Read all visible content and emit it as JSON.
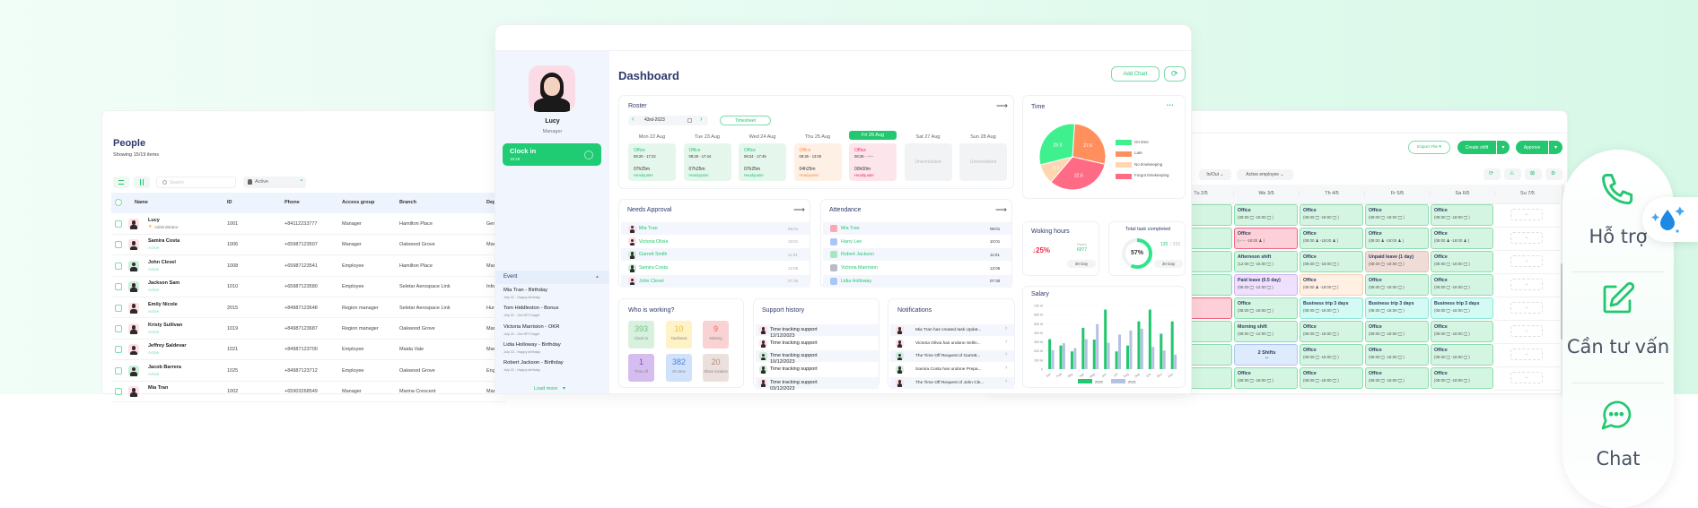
{
  "people": {
    "title": "People",
    "subtitle": "Showing 15/19 items",
    "search_placeholder": "Search",
    "status_filter": "Active",
    "columns": [
      "Name",
      "ID",
      "Phone",
      "Access group",
      "Branch",
      "Dep"
    ],
    "rows": [
      {
        "name": "Lucy",
        "sub": "Administrator",
        "id": "1001",
        "phone": "+84112233777",
        "group": "Manager",
        "branch": "Hamilton Place",
        "dep": "Gen"
      },
      {
        "name": "Samira Costa",
        "sub": "Active",
        "id": "1006",
        "phone": "+65987123507",
        "group": "Manager",
        "branch": "Oakwood Grove",
        "dep": "Mar"
      },
      {
        "name": "John Clevel",
        "sub": "Active",
        "id": "1008",
        "phone": "+65987123541",
        "group": "Employee",
        "branch": "Hamilton Place",
        "dep": "Mar"
      },
      {
        "name": "Jackson Sam",
        "sub": "Active",
        "id": "1010",
        "phone": "+65987123580",
        "group": "Employee",
        "branch": "Seletar Aerospace Link",
        "dep": "Info"
      },
      {
        "name": "Emily Nicole",
        "sub": "Active",
        "id": "2015",
        "phone": "+84987123648",
        "group": "Region manager",
        "branch": "Seletar Aerospace Link",
        "dep": "Hur"
      },
      {
        "name": "Kristy Sullivan",
        "sub": "Active",
        "id": "1019",
        "phone": "+84987123687",
        "group": "Region manager",
        "branch": "Oakwood Grove",
        "dep": "Mar"
      },
      {
        "name": "Jeffrey Saldevar",
        "sub": "Active",
        "id": "1021",
        "phone": "+84987123700",
        "group": "Employee",
        "branch": "Maida Vale",
        "dep": "Mar"
      },
      {
        "name": "Jacob Barrera",
        "sub": "Active",
        "id": "1025",
        "phone": "+84987123712",
        "group": "Employee",
        "branch": "Oakwood Grove",
        "dep": "Eng"
      },
      {
        "name": "Mia Tran",
        "sub": "",
        "id": "1002",
        "phone": "+65903268549",
        "group": "Manager",
        "branch": "Marina Crescent",
        "dep": "Mar"
      }
    ]
  },
  "dashboard": {
    "user": {
      "name": "Lucy",
      "role": "Manager"
    },
    "clock_in": {
      "label": "Clock in",
      "time": "18:29"
    },
    "event": {
      "title": "Event",
      "items": [
        {
          "title": "Mia Tran - Birthday",
          "sub": "July 22 - Happy birthday"
        },
        {
          "title": "Tom Hiddleston - Bonus",
          "sub": "July 22 - Get KPI Target"
        },
        {
          "title": "Victoria Marrision - OKR",
          "sub": "July 22 - Get KPI Target"
        },
        {
          "title": "Lidia Holloway - Birthday",
          "sub": "July 22 - Happy birthday"
        },
        {
          "title": "Robert Jackson - Birthday",
          "sub": "July 22 - Happy birthday"
        }
      ],
      "load_more": "Load more"
    },
    "title": "Dashboard",
    "add_chart": "Add Chart",
    "roster": {
      "title": "Roster",
      "date": "43rd-2023",
      "timesheet": "Timesheet",
      "days": [
        {
          "day": "Mon 22 Aug",
          "loc": "Office",
          "time": "08:20 - 17:22",
          "dur": "07h25m",
          "site": "Headquater",
          "status": "ok"
        },
        {
          "day": "Tue 23 Aug",
          "loc": "Office",
          "time": "08:29 - 17:44",
          "dur": "07h25m",
          "site": "Headquater",
          "status": "ok"
        },
        {
          "day": "Wed 24 Aug",
          "loc": "Office",
          "time": "08:24 - 17:45",
          "dur": "07h25m",
          "site": "Headquater",
          "status": "ok"
        },
        {
          "day": "Thu 25 Aug",
          "loc": "Office",
          "time": "08:26 - 13:00",
          "dur": "04h25m",
          "site": "Headquater",
          "status": "late"
        },
        {
          "day": "Fri 26 Aug",
          "loc": "Office",
          "time": "08:26 - --:--",
          "dur": "00h00m",
          "site": "Headquater",
          "status": "missing",
          "today": true
        },
        {
          "day": "Sat 27 Aug",
          "unscheduled": "Unscheduled"
        },
        {
          "day": "Sun 28 Aug",
          "unscheduled": "Unscheduled"
        }
      ]
    },
    "needs_approval": {
      "title": "Needs Approval",
      "rows": [
        {
          "name": "Mia Tran",
          "time": "09:01"
        },
        {
          "name": "Victoria Olivia",
          "time": "10:01"
        },
        {
          "name": "Garrett Smith",
          "time": "11:01"
        },
        {
          "name": "Samira Costa",
          "time": "12:05"
        },
        {
          "name": "John Clevel",
          "time": "07:30"
        }
      ]
    },
    "attendance": {
      "title": "Attendance",
      "rows": [
        {
          "name": "Mia Tran",
          "time": "09:01"
        },
        {
          "name": "Harry Lee",
          "time": "10:01"
        },
        {
          "name": "Robert Jackson",
          "time": "11:01"
        },
        {
          "name": "Victoria Marrision",
          "time": "12:05"
        },
        {
          "name": "Lidia Holloway",
          "time": "07:30"
        }
      ]
    },
    "who_is_working": {
      "title": "Who is working?",
      "tiles": [
        {
          "value": "393",
          "label": "Clock in",
          "bg": "#d8f1de",
          "fg": "#6fc284"
        },
        {
          "value": "10",
          "label": "Tardiness",
          "bg": "#fdf3c6",
          "fg": "#e8c13f"
        },
        {
          "value": "9",
          "label": "Missing",
          "bg": "#f9d3d3",
          "fg": "#ef6464"
        },
        {
          "value": "1",
          "label": "Time off",
          "bg": "#d6bdf0",
          "fg": "#8448c6"
        },
        {
          "value": "382",
          "label": "On time",
          "bg": "#d0e1fb",
          "fg": "#4c84e4"
        },
        {
          "value": "20",
          "label": "Share location",
          "bg": "#ebe0dc",
          "fg": "#b98c7d"
        }
      ]
    },
    "support_history": {
      "title": "Support history",
      "items": [
        {
          "title": "Time tracking support",
          "date": "12/12/2023"
        },
        {
          "title": "Time tracking support",
          "date": ""
        },
        {
          "title": "Time tracking support",
          "date": "10/12/2023"
        },
        {
          "title": "Time tracking support",
          "date": ""
        },
        {
          "title": "Time tracking support",
          "date": "03/12/2023"
        }
      ]
    },
    "notifications": {
      "title": "Notifications",
      "items": [
        "Mia Tran has created task Updat...",
        "Victoria Olivia has undone Sellin...",
        "The Time Off Request of Garrett...",
        "Samira Costa has undone Prepa...",
        "The Time Off Request of John Cle..."
      ]
    },
    "time": {
      "title": "Time"
    },
    "working_hours": {
      "title": "Woking hours",
      "change": "↓25%",
      "hours_label": "Hours",
      "hours": "6977",
      "period": "30 Day"
    },
    "total_task": {
      "title": "Total task completed",
      "percent": 57,
      "percent_label": "57%",
      "done": "125",
      "total": "/ 250",
      "period": "30 Day"
    },
    "salary": {
      "title": "Salary"
    }
  },
  "schedule": {
    "export": "Export File",
    "create_shift": "Create shift",
    "approve": "Approve",
    "filters": [
      "In/Out",
      "Active employee"
    ],
    "days": [
      "Tu 2/5",
      "We 3/5",
      "Th 4/5",
      "Fr 5/5",
      "Sa 6/5",
      "Su 7/5"
    ],
    "rows": [
      [
        {
          "t": "",
          "s": "18:00 🖵 )",
          "k": "g"
        },
        {
          "t": "Office",
          "s": "(08:00 🖵 -18:00 🖵 )",
          "k": "g"
        },
        {
          "t": "Office",
          "s": "(08:00 🖵 -18:00 🖵 )",
          "k": "g"
        },
        {
          "t": "Office",
          "s": "(08:00 🖵 -18:00 🖵 )",
          "k": "g"
        },
        {
          "t": "Office",
          "s": "(08:00 🖵 -18:00 🖵 )",
          "k": "g"
        }
      ],
      [
        {
          "t": "",
          "s": "18:00 ♟ )",
          "k": "g"
        },
        {
          "t": "Office",
          "s": "(--:-- -18:00 ♟ )",
          "k": "r"
        },
        {
          "t": "Office",
          "s": "(08:00 ♟ -18:00 ♟ )",
          "k": "g"
        },
        {
          "t": "Office",
          "s": "(08:00 ♟ -18:00 ♟ )",
          "k": "g"
        },
        {
          "t": "Office",
          "s": "(08:00 ♟ -18:00 ♟ )",
          "k": "g"
        }
      ],
      [
        {
          "t": "n shift",
          "s": "16:00 🖵 )",
          "k": "g"
        },
        {
          "t": "Afternoon shift",
          "s": "(12:00 🖵 -16:00 🖵 )",
          "k": "g"
        },
        {
          "t": "Office",
          "s": "(08:00 🖵 -18:00 🖵 )",
          "k": "g"
        },
        {
          "t": "Unpaid leave (1 day)",
          "s": "(08:00 🖵 -18:00 🖵 )",
          "k": "b"
        },
        {
          "t": "Office",
          "s": "(08:00 🖵 -18:00 🖵 )",
          "k": "g"
        }
      ],
      [
        {
          "t": "",
          "s": "18:00 🖵 )",
          "k": "g"
        },
        {
          "t": "Paid leave (0.5 day)",
          "s": "(08:00 🖵 -12:00 🖵 )",
          "k": "p"
        },
        {
          "t": "Office",
          "s": "(08:00 ♟ -18:00 🖵 )",
          "k": "o"
        },
        {
          "t": "Office",
          "s": "(08:00 🖵 -18:00 🖵 )",
          "k": "g"
        },
        {
          "t": "Office",
          "s": "(08:00 🖵 -18:00 🖵 )",
          "k": "g"
        }
      ],
      [
        {
          "t": "",
          "s": "--:-- )",
          "k": "r"
        },
        {
          "t": "Office",
          "s": "(08:00 🖵 -18:00 🖵 )",
          "k": "g"
        },
        {
          "t": "Business trip 3 days",
          "s": "(08:00 🖵 -18:00 🖵 )",
          "k": "c"
        },
        {
          "t": "Business trip 3 days",
          "s": "(08:00 🖵 -18:00 🖵 )",
          "k": "c"
        },
        {
          "t": "Business trip 3 days",
          "s": "(08:00 🖵 -18:00 🖵 )",
          "k": "c"
        }
      ],
      [
        {
          "t": "hift",
          "s": "12:00 🖵 )",
          "k": "g"
        },
        {
          "t": "Morning shift",
          "s": "(08:00 🖵 -12:00 🖵 )",
          "k": "g"
        },
        {
          "t": "Office",
          "s": "(08:00 🖵 -18:00 🖵 )",
          "k": "g"
        },
        {
          "t": "Office",
          "s": "(08:00 🖵 -18:00 🖵 )",
          "k": "g"
        },
        {
          "t": "Office",
          "s": "(08:00 🖵 -18:00 🖵 )",
          "k": "g"
        }
      ],
      [
        {
          "t": "",
          "s": "18:00 🖵 )",
          "k": "g"
        },
        {
          "t": "2 Shifts",
          "s": "",
          "k": "u"
        },
        {
          "t": "Office",
          "s": "(08:00 🖵 -18:00 🖵 )",
          "k": "g"
        },
        {
          "t": "Office",
          "s": "(08:00 🖵 -18:00 🖵 )",
          "k": "g"
        },
        {
          "t": "Office",
          "s": "(08:00 🖵 -18:00 🖵 )",
          "k": "g"
        }
      ],
      [
        {
          "t": "",
          "s": "18:00 🖵 )",
          "k": "g"
        },
        {
          "t": "Office",
          "s": "(08:00 🖵 -18:00 🖵 )",
          "k": "g"
        },
        {
          "t": "Office",
          "s": "(08:00 🖵 -18:00 🖵 )",
          "k": "g"
        },
        {
          "t": "Office",
          "s": "(08:00 🖵 -18:00 🖵 )",
          "k": "g"
        },
        {
          "t": "Office",
          "s": "(08:00 🖵 -18:00 🖵 )",
          "k": "g"
        }
      ]
    ],
    "add_symbol": "+"
  },
  "widget": {
    "items": [
      {
        "label": "Hỗ trợ",
        "icon": "phone-icon"
      },
      {
        "label": "Cần tư vấn",
        "icon": "edit-icon"
      },
      {
        "label": "Chat",
        "icon": "chat-icon"
      }
    ],
    "bubble_icon": "water-drop-icon"
  },
  "colors": {
    "accent": "#22c76f",
    "navy": "#2d3a6b"
  },
  "chart_data": [
    {
      "type": "pie",
      "title": "Time",
      "categories": [
        "On time",
        "Late",
        "No timekeeping",
        "Forgot timekeeping"
      ],
      "values": [
        29.9,
        27.6,
        9.9,
        32.6
      ],
      "colors": [
        "#3ff08f",
        "#ff8f5c",
        "#ffd6b0",
        "#ff6b85"
      ],
      "legend": "right"
    },
    {
      "type": "bar",
      "title": "Salary",
      "categories": [
        "Jan",
        "Feb",
        "Mar",
        "Apr",
        "May",
        "Jun",
        "Jul",
        "Aug",
        "Sep",
        "Oct",
        "Nov",
        "Dec"
      ],
      "series": [
        {
          "name": "2022",
          "values": [
            330,
            260,
            195,
            455,
            325,
            655,
            195,
            260,
            525,
            655,
            390,
            525
          ],
          "color": "#22c76f"
        },
        {
          "name": "2021",
          "values": [
            210,
            285,
            230,
            330,
            495,
            290,
            380,
            425,
            445,
            245,
            205,
            160
          ],
          "color": "#b5c1e3"
        }
      ],
      "yticks": [
        "0",
        "100 M",
        "200 M",
        "300 M",
        "400 M",
        "500 M",
        "600 M",
        "700 M"
      ],
      "ylim": [
        0,
        700
      ],
      "grid": true,
      "legend": "bottom"
    }
  ]
}
